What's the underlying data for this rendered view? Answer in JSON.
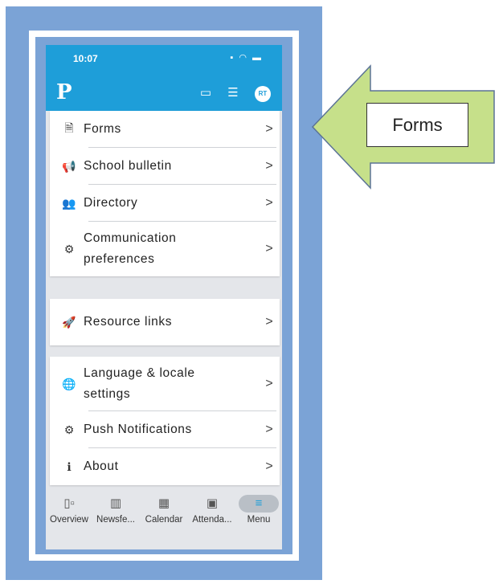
{
  "status": {
    "time": "10:07"
  },
  "header": {
    "avatar_initials": "RT",
    "logo_letter": "P"
  },
  "groups": [
    [
      {
        "icon": "forms-icon",
        "label": "Forms"
      },
      {
        "icon": "megaphone-icon",
        "label": "School bulletin"
      },
      {
        "icon": "people-icon",
        "label": "Directory"
      },
      {
        "icon": "settings-gear-icon",
        "label_line1": "Communication",
        "label_line2": "preferences"
      }
    ],
    [
      {
        "icon": "rocket-icon",
        "label": "Resource links"
      }
    ],
    [
      {
        "icon": "globe-gear-icon",
        "label_line1": "Language & locale",
        "label_line2": "settings"
      },
      {
        "icon": "settings-gear-icon",
        "label": "Push Notifications"
      },
      {
        "icon": "info-icon",
        "label": "About"
      }
    ]
  ],
  "chevron": ">",
  "tabs": [
    {
      "label": "Overview"
    },
    {
      "label": "Newsfe..."
    },
    {
      "label": "Calendar"
    },
    {
      "label": "Attenda..."
    },
    {
      "label": "Menu"
    }
  ],
  "callout": {
    "text": "Forms",
    "fill_color": "#c6e08a",
    "border_color": "#5b7396"
  },
  "colors": {
    "brand_blue": "#1e9ed9",
    "frame_blue": "#7ba3d6"
  }
}
